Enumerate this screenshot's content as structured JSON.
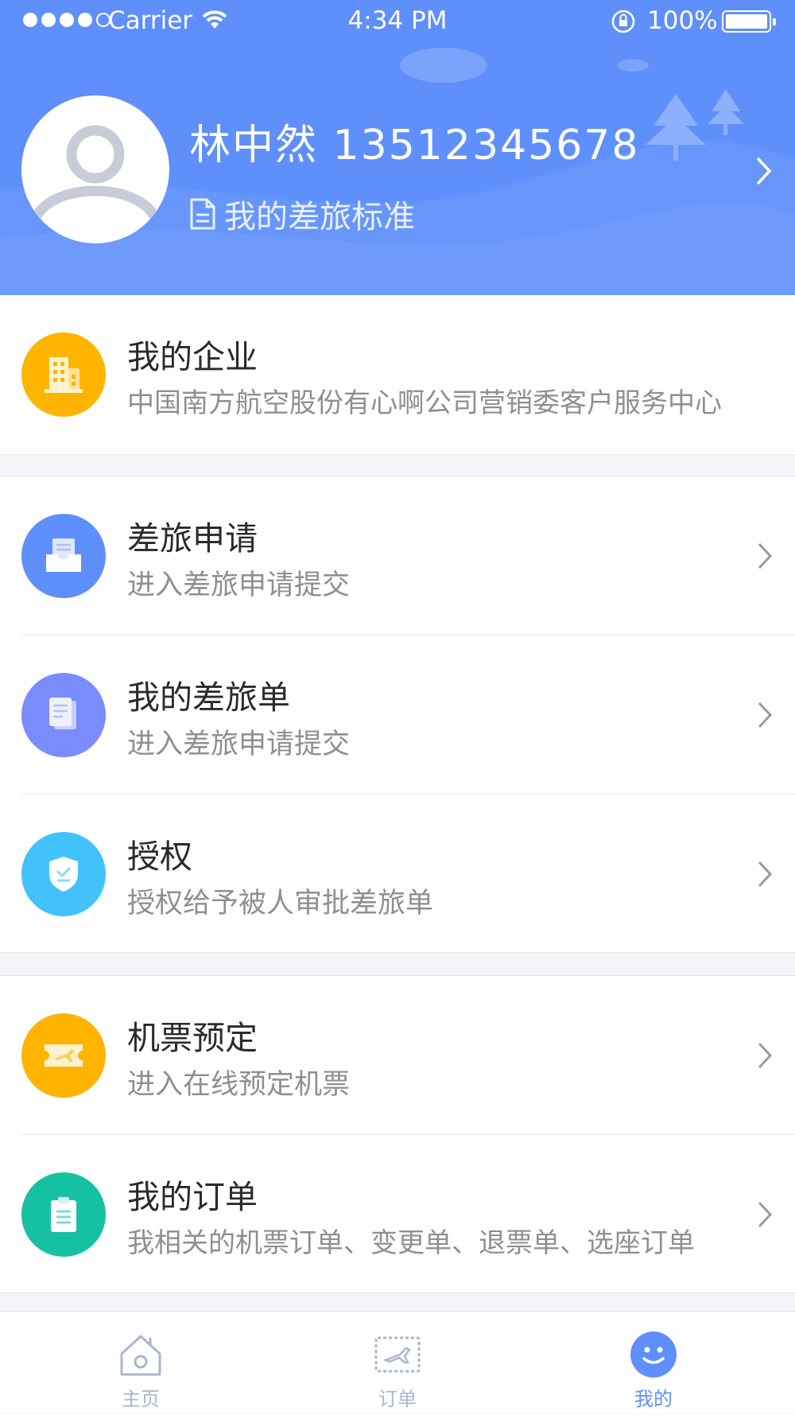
{
  "status_bar": {
    "carrier": "Carrier",
    "time": "4:34 PM",
    "battery": "100%"
  },
  "profile": {
    "name_phone": "林中然 13512345678",
    "travel_standard": "我的差旅标准"
  },
  "company": {
    "title": "我的企业",
    "subtitle": "中国南方航空股份有心啊公司营销委客户服务中心",
    "icon": "building-icon",
    "color": "#ffb400"
  },
  "travel_section": [
    {
      "title": "差旅申请",
      "subtitle": "进入差旅申请提交",
      "icon": "inbox-icon",
      "color": "#5f8ffb"
    },
    {
      "title": "我的差旅单",
      "subtitle": "进入差旅申请提交",
      "icon": "documents-icon",
      "color": "#7a8cfb"
    },
    {
      "title": "授权",
      "subtitle": "授权给予被人审批差旅单",
      "icon": "shield-icon",
      "color": "#42c2fb"
    }
  ],
  "booking_section": [
    {
      "title": "机票预定",
      "subtitle": "进入在线预定机票",
      "icon": "ticket-icon",
      "color": "#ffb400"
    },
    {
      "title": "我的订单",
      "subtitle": "我相关的机票订单、变更单、退票单、选座订单",
      "icon": "clipboard-icon",
      "color": "#16c1a1"
    }
  ],
  "tabs": [
    {
      "label": "主页",
      "icon": "home-icon",
      "active": false
    },
    {
      "label": "订单",
      "icon": "ticket-icon",
      "active": false
    },
    {
      "label": "我的",
      "icon": "smiley-icon",
      "active": true
    }
  ],
  "colors": {
    "header_bg": "#5f8ffb",
    "accent": "#5f8ffb",
    "tab_inactive": "#a8b6d0"
  }
}
